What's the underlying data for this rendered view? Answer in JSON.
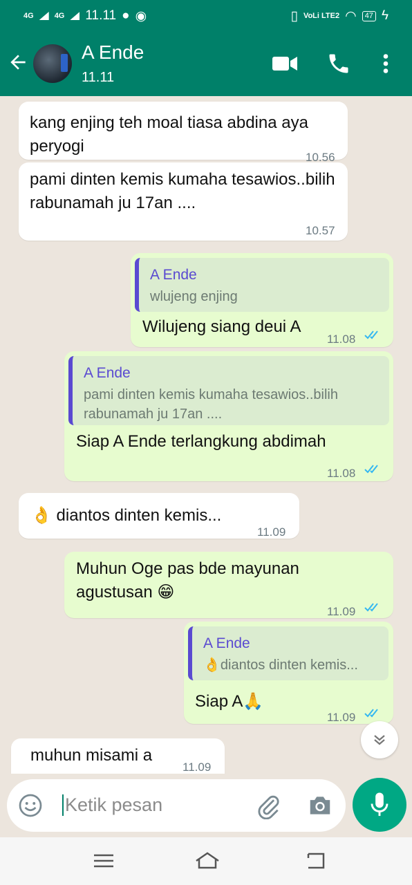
{
  "status_bar": {
    "net1": "4G",
    "net2": "4G",
    "time": "11.11",
    "volte": "VoLi LTE2",
    "battery": "47"
  },
  "header": {
    "contact_name": "A Ende",
    "contact_status": "11.11"
  },
  "messages": [
    {
      "dir": "in",
      "text": "kang enjing teh moal tiasa abdina aya peryogi",
      "time": "10.56"
    },
    {
      "dir": "in",
      "text": "pami dinten kemis kumaha tesawios..bilih rabunamah ju 17an ....",
      "time": "10.57"
    },
    {
      "dir": "out",
      "quote_name": "A Ende",
      "quote_text": "wlujeng enjing",
      "text": "Wilujeng siang deui A",
      "time": "11.08"
    },
    {
      "dir": "out",
      "quote_name": "A Ende",
      "quote_text": "pami dinten kemis kumaha tesawios..bilih rabunamah ju 17an ....",
      "text": "Siap A Ende terlangkung abdimah",
      "time": "11.08"
    },
    {
      "dir": "in",
      "text": "👌 diantos dinten kemis...",
      "time": "11.09"
    },
    {
      "dir": "out",
      "text": "Muhun Oge pas bde mayunan agustusan 😁",
      "time": "11.09"
    },
    {
      "dir": "out",
      "quote_name": "A Ende",
      "quote_text": "👌diantos dinten kemis...",
      "text": "Siap A🙏",
      "time": "11.09"
    },
    {
      "dir": "in",
      "text": "muhun misami a",
      "time": "11.09"
    }
  ],
  "input": {
    "placeholder": "Ketik pesan"
  },
  "colors": {
    "header": "#008069",
    "outgoing_bubble": "#e7fccf",
    "incoming_bubble": "#ffffff",
    "quote_accent": "#5a4ad1",
    "read_ticks": "#34b7f1",
    "mic_button": "#00a884"
  },
  "icons": {
    "back": "arrow-left-icon",
    "video": "video-call-icon",
    "call": "phone-icon",
    "menu": "more-vertical-icon",
    "emoji": "emoji-icon",
    "attach": "paperclip-icon",
    "camera": "camera-icon",
    "mic": "microphone-icon",
    "scroll_down": "double-chevron-down-icon"
  }
}
